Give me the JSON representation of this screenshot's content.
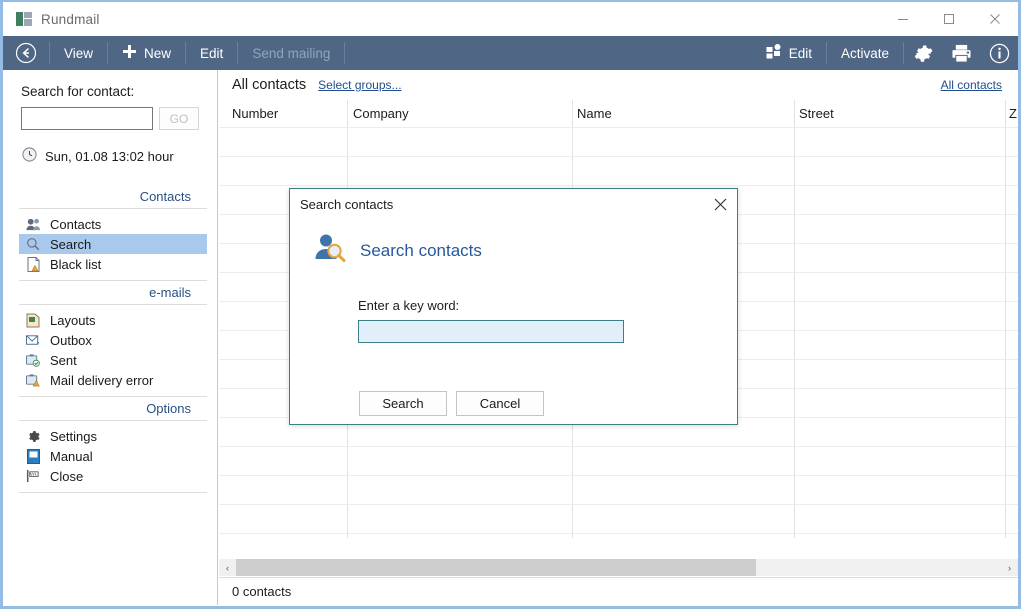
{
  "window": {
    "title": "Rundmail",
    "icon": "app-icon",
    "controls": {
      "minimize": "–",
      "maximize": "□",
      "close": "✕"
    }
  },
  "toolbar": {
    "back": "back-arrow-icon",
    "left_items": [
      {
        "label": "View",
        "icon": "",
        "disabled": false
      },
      {
        "label": "New",
        "icon": "plus-icon",
        "disabled": false
      },
      {
        "label": "Edit",
        "icon": "",
        "disabled": false
      },
      {
        "label": "Send mailing",
        "icon": "",
        "disabled": true
      }
    ],
    "right_items": [
      {
        "label": "Edit",
        "icon": "groups-icon"
      },
      {
        "label": "Activate",
        "icon": ""
      }
    ],
    "right_icons": [
      "gear-icon",
      "printer-icon",
      "info-icon"
    ]
  },
  "sidebar": {
    "search_label": "Search for contact:",
    "search_value": "",
    "search_placeholder": "",
    "go_label": "GO",
    "clock": "Sun, 01.08  13:02 hour",
    "sections": [
      {
        "title": "Contacts",
        "items": [
          {
            "label": "Contacts",
            "icon": "contacts-icon",
            "active": false
          },
          {
            "label": "Search",
            "icon": "magnifier-icon",
            "active": true
          },
          {
            "label": "Black list",
            "icon": "blacklist-icon",
            "active": false
          }
        ]
      },
      {
        "title": "e-mails",
        "items": [
          {
            "label": "Layouts",
            "icon": "layouts-icon",
            "active": false
          },
          {
            "label": "Outbox",
            "icon": "outbox-icon",
            "active": false
          },
          {
            "label": "Sent",
            "icon": "sent-icon",
            "active": false
          },
          {
            "label": "Mail delivery error",
            "icon": "mail-error-icon",
            "active": false
          }
        ]
      },
      {
        "title": "Options",
        "items": [
          {
            "label": "Settings",
            "icon": "gear-icon",
            "active": false
          },
          {
            "label": "Manual",
            "icon": "book-icon",
            "active": false
          },
          {
            "label": "Close",
            "icon": "exit-icon",
            "active": false
          }
        ]
      }
    ]
  },
  "main": {
    "title": "All contacts",
    "select_groups_link": "Select groups...",
    "all_contacts_link": "All contacts",
    "columns": [
      "Number",
      "Company",
      "Name",
      "Street",
      "ZIP"
    ],
    "rows": [],
    "status": "0 contacts",
    "scroll_left_arrow": "‹",
    "scroll_right_arrow": "›"
  },
  "dialog": {
    "titlebar": "Search contacts",
    "close_icon": "close-icon",
    "heading": "Search contacts",
    "heading_icon": "person-search-icon",
    "field_label": "Enter a key word:",
    "field_value": "",
    "field_placeholder": "",
    "buttons": [
      {
        "label": "Search",
        "name": "search-button"
      },
      {
        "label": "Cancel",
        "name": "cancel-button"
      }
    ]
  },
  "colors": {
    "toolbar_bg": "#4f6684",
    "window_border": "#95bce4",
    "accent_link": "#1f4e8c",
    "selection": "#a8c8ec",
    "dialog_border": "#3b7f87",
    "dialog_input_bg": "#e2effa",
    "heading_blue": "#26599c"
  }
}
